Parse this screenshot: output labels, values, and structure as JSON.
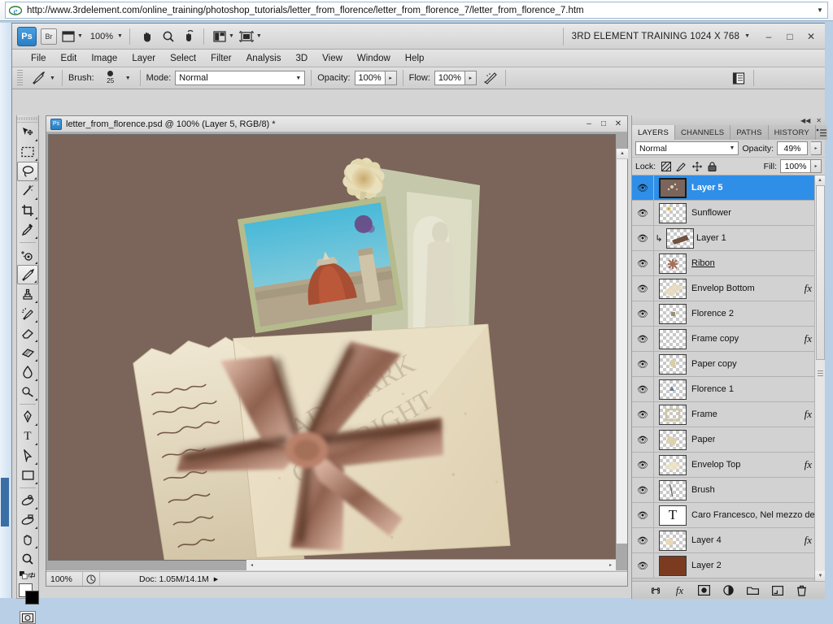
{
  "browser": {
    "url": "http://www.3rdelement.com/online_training/photoshop_tutorials/letter_from_florence/letter_from_florence_7/letter_from_florence_7.htm",
    "favicon": "ie-icon",
    "url_dropdown": "▼"
  },
  "app": {
    "logo": "Ps",
    "bridge_label": "Br",
    "view_extras_icon": "screen-mode-icon",
    "zoom_level": "100%",
    "workspace_name": "3RD ELEMENT TRAINING 1024 X 768",
    "window_buttons": {
      "minimize": "–",
      "maximize": "□",
      "close": "✕"
    },
    "caret": "▼"
  },
  "menubar": {
    "items": [
      "File",
      "Edit",
      "Image",
      "Layer",
      "Select",
      "Filter",
      "Analysis",
      "3D",
      "View",
      "Window",
      "Help"
    ]
  },
  "options_bar": {
    "tool_icon": "brush-tool-icon",
    "brush_label": "Brush:",
    "brush_size": "25",
    "mode_label": "Mode:",
    "mode_value": "Normal",
    "opacity_label": "Opacity:",
    "opacity_value": "100%",
    "flow_label": "Flow:",
    "flow_value": "100%",
    "airbrush_icon": "airbrush-icon",
    "palette_icon": "toggle-panels-icon",
    "stepper": "▸"
  },
  "toolbox": {
    "tools": [
      {
        "name": "move-tool",
        "glyph": "move-icon",
        "selected": false,
        "has_more": true
      },
      {
        "name": "rectangular-marquee-tool",
        "glyph": "marquee-icon",
        "selected": false,
        "has_more": true
      },
      {
        "name": "lasso-tool",
        "glyph": "lasso-icon",
        "selected": true,
        "has_more": true
      },
      {
        "name": "magic-wand-tool",
        "glyph": "wand-icon",
        "selected": false,
        "has_more": true
      },
      {
        "name": "crop-tool",
        "glyph": "crop-icon",
        "selected": false,
        "has_more": true
      },
      {
        "name": "eyedropper-tool",
        "glyph": "eyedropper-icon",
        "selected": false,
        "has_more": true
      },
      {
        "name": "spot-healing-brush-tool",
        "glyph": "healing-icon",
        "selected": false,
        "has_more": true
      },
      {
        "name": "brush-tool",
        "glyph": "brush-icon",
        "selected": true,
        "has_more": true
      },
      {
        "name": "clone-stamp-tool",
        "glyph": "stamp-icon",
        "selected": false,
        "has_more": true
      },
      {
        "name": "history-brush-tool",
        "glyph": "history-brush-icon",
        "selected": false,
        "has_more": true
      },
      {
        "name": "eraser-tool",
        "glyph": "eraser-icon",
        "selected": false,
        "has_more": true
      },
      {
        "name": "gradient-tool",
        "glyph": "gradient-icon",
        "selected": false,
        "has_more": true
      },
      {
        "name": "blur-tool",
        "glyph": "blur-drop-icon",
        "selected": false,
        "has_more": true
      },
      {
        "name": "dodge-tool",
        "glyph": "dodge-icon",
        "selected": false,
        "has_more": true
      },
      {
        "name": "pen-tool",
        "glyph": "pen-icon",
        "selected": false,
        "has_more": true
      },
      {
        "name": "horizontal-type-tool",
        "glyph": "text-icon",
        "selected": false,
        "has_more": true
      },
      {
        "name": "path-selection-tool",
        "glyph": "path-arrow-icon",
        "selected": false,
        "has_more": true
      },
      {
        "name": "rectangle-tool",
        "glyph": "shape-icon",
        "selected": false,
        "has_more": true
      },
      {
        "name": "3d-rotate-tool",
        "glyph": "3d-rotate-icon",
        "selected": false,
        "has_more": true
      },
      {
        "name": "3d-orbit-tool",
        "glyph": "3d-orbit-icon",
        "selected": false,
        "has_more": true
      },
      {
        "name": "hand-tool",
        "glyph": "hand-icon",
        "selected": false,
        "has_more": true
      },
      {
        "name": "zoom-tool",
        "glyph": "magnifier-icon",
        "selected": false,
        "has_more": false
      }
    ],
    "foreground_color": "#ffffff",
    "background_color": "#000000",
    "quick_mask_icon": "quick-mask-icon",
    "swap_colors_icon": "swap-colors-icon"
  },
  "document": {
    "title": "letter_from_florence.psd @ 100% (Layer 5, RGB/8) *",
    "window_buttons": {
      "minimize": "–",
      "maximize": "□",
      "close": "✕"
    },
    "status_zoom": "100%",
    "status_doc": "Doc: 1.05M/14.1M",
    "status_arrow": "▶",
    "canvas_background": "#7b6459",
    "scroll_up": "▲",
    "scroll_left": "◂",
    "scroll_right": "▸"
  },
  "layers_panel": {
    "collapse_icon": "◀◀",
    "close_icon": "✕",
    "tabs": [
      {
        "label": "LAYERS",
        "active": true
      },
      {
        "label": "CHANNELS",
        "active": false
      },
      {
        "label": "PATHS",
        "active": false
      },
      {
        "label": "HISTORY",
        "active": false
      }
    ],
    "menu_icon": "panel-menu-icon",
    "blend_mode": "Normal",
    "opacity_label": "Opacity:",
    "opacity_value": "49%",
    "lock_label": "Lock:",
    "lock_icons": [
      "lock-transparent-pixels-icon",
      "lock-image-pixels-icon",
      "lock-position-icon",
      "lock-all-icon"
    ],
    "fill_label": "Fill:",
    "fill_value": "100%",
    "stepper": "▸",
    "caret": "▼",
    "layers": [
      {
        "name": "Layer 5",
        "selected": true,
        "visible": true,
        "fx": false,
        "clipped": false,
        "underline": false,
        "thumb": "dots",
        "thumb_bg": "#7b6459"
      },
      {
        "name": "Sunflower",
        "selected": false,
        "visible": true,
        "fx": false,
        "clipped": false,
        "underline": false,
        "thumb": "sunflower",
        "thumb_bg": ""
      },
      {
        "name": "Layer 1",
        "selected": false,
        "visible": true,
        "fx": false,
        "clipped": true,
        "underline": false,
        "thumb": "brownstrip",
        "thumb_bg": ""
      },
      {
        "name": "Ribon",
        "selected": false,
        "visible": true,
        "fx": false,
        "clipped": false,
        "underline": true,
        "thumb": "ribbon",
        "thumb_bg": ""
      },
      {
        "name": "Envelop Bottom",
        "selected": false,
        "visible": true,
        "fx": true,
        "clipped": false,
        "underline": false,
        "thumb": "paper",
        "thumb_bg": ""
      },
      {
        "name": "Florence 2",
        "selected": false,
        "visible": true,
        "fx": false,
        "clipped": false,
        "underline": false,
        "thumb": "small",
        "thumb_bg": ""
      },
      {
        "name": "Frame copy",
        "selected": false,
        "visible": true,
        "fx": true,
        "clipped": false,
        "underline": false,
        "thumb": "empty",
        "thumb_bg": ""
      },
      {
        "name": "Paper copy",
        "selected": false,
        "visible": true,
        "fx": false,
        "clipped": false,
        "underline": false,
        "thumb": "paper",
        "thumb_bg": ""
      },
      {
        "name": "Florence 1",
        "selected": false,
        "visible": true,
        "fx": false,
        "clipped": false,
        "underline": false,
        "thumb": "small",
        "thumb_bg": ""
      },
      {
        "name": "Frame",
        "selected": false,
        "visible": true,
        "fx": true,
        "clipped": false,
        "underline": false,
        "thumb": "paper",
        "thumb_bg": ""
      },
      {
        "name": "Paper",
        "selected": false,
        "visible": true,
        "fx": false,
        "clipped": false,
        "underline": false,
        "thumb": "paper",
        "thumb_bg": ""
      },
      {
        "name": "Envelop Top",
        "selected": false,
        "visible": true,
        "fx": true,
        "clipped": false,
        "underline": false,
        "thumb": "paper",
        "thumb_bg": ""
      },
      {
        "name": "Brush",
        "selected": false,
        "visible": true,
        "fx": false,
        "clipped": false,
        "underline": false,
        "thumb": "stroke",
        "thumb_bg": ""
      },
      {
        "name": "Caro Francesco, Nel mezzo de...",
        "selected": false,
        "visible": true,
        "fx": false,
        "clipped": false,
        "underline": false,
        "thumb": "text",
        "thumb_bg": "#ffffff"
      },
      {
        "name": "Layer 4",
        "selected": false,
        "visible": true,
        "fx": true,
        "clipped": false,
        "underline": false,
        "thumb": "blob",
        "thumb_bg": ""
      },
      {
        "name": "Layer 2",
        "selected": false,
        "visible": true,
        "fx": false,
        "clipped": false,
        "underline": false,
        "thumb": "solid",
        "thumb_bg": "#7a3b20"
      }
    ],
    "bottom_buttons": [
      {
        "name": "link-layers-button",
        "glyph": "link-icon"
      },
      {
        "name": "layer-style-button",
        "glyph": "fx-icon"
      },
      {
        "name": "layer-mask-button",
        "glyph": "mask-icon"
      },
      {
        "name": "adjustment-layer-button",
        "glyph": "half-circle-icon"
      },
      {
        "name": "new-group-button",
        "glyph": "folder-icon"
      },
      {
        "name": "new-layer-button",
        "glyph": "new-layer-icon"
      },
      {
        "name": "delete-layer-button",
        "glyph": "trash-icon"
      }
    ],
    "scroll_up": "▲",
    "scroll_down": "▼"
  }
}
